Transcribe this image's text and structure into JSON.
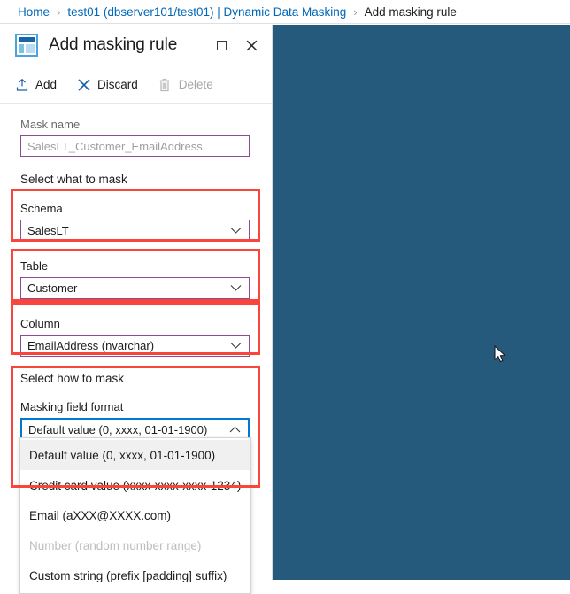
{
  "breadcrumb": {
    "items": [
      {
        "label": "Home",
        "current": false
      },
      {
        "label": "test01 (dbserver101/test01) | Dynamic Data Masking",
        "current": false
      },
      {
        "label": "Add masking rule",
        "current": true
      }
    ],
    "separator": "›"
  },
  "blade": {
    "icon": "data-masking-rule-icon",
    "title": "Add masking rule",
    "maximize_label": "☐",
    "close_label": "✕"
  },
  "toolbar": {
    "commands": [
      {
        "label": "Add",
        "icon": "upload-icon",
        "disabled": false
      },
      {
        "label": "Discard",
        "icon": "cross-icon",
        "disabled": false
      },
      {
        "label": "Delete",
        "icon": "trash-icon",
        "disabled": true
      }
    ]
  },
  "form": {
    "mask_name": {
      "label": "Mask name",
      "value": "SalesLT_Customer_EmailAddress"
    },
    "select_what_label": "Select what to mask",
    "schema": {
      "label": "Schema",
      "value": "SalesLT"
    },
    "table": {
      "label": "Table",
      "value": "Customer"
    },
    "column": {
      "label": "Column",
      "value": "EmailAddress (nvarchar)"
    },
    "select_how_label": "Select how to mask",
    "masking_field_format": {
      "label": "Masking field format",
      "value": "Default value (0, xxxx, 01-01-1900)",
      "expanded": true,
      "options": [
        {
          "label": "Default value (0, xxxx, 01-01-1900)",
          "selected": true,
          "disabled": false
        },
        {
          "label": "Credit card value (xxxx-xxxx-xxxx-1234)",
          "selected": false,
          "disabled": false
        },
        {
          "label": "Email (aXXX@XXXX.com)",
          "selected": false,
          "disabled": false
        },
        {
          "label": "Number (random number range)",
          "selected": false,
          "disabled": true
        },
        {
          "label": "Custom string (prefix [padding] suffix)",
          "selected": false,
          "disabled": false
        }
      ]
    }
  },
  "colors": {
    "accent_blue": "#0078d4",
    "link_blue": "#0067b8",
    "annotation_red": "#f8463c",
    "field_purple": "#8e4a94",
    "backdrop_teal": "#265a7d"
  }
}
